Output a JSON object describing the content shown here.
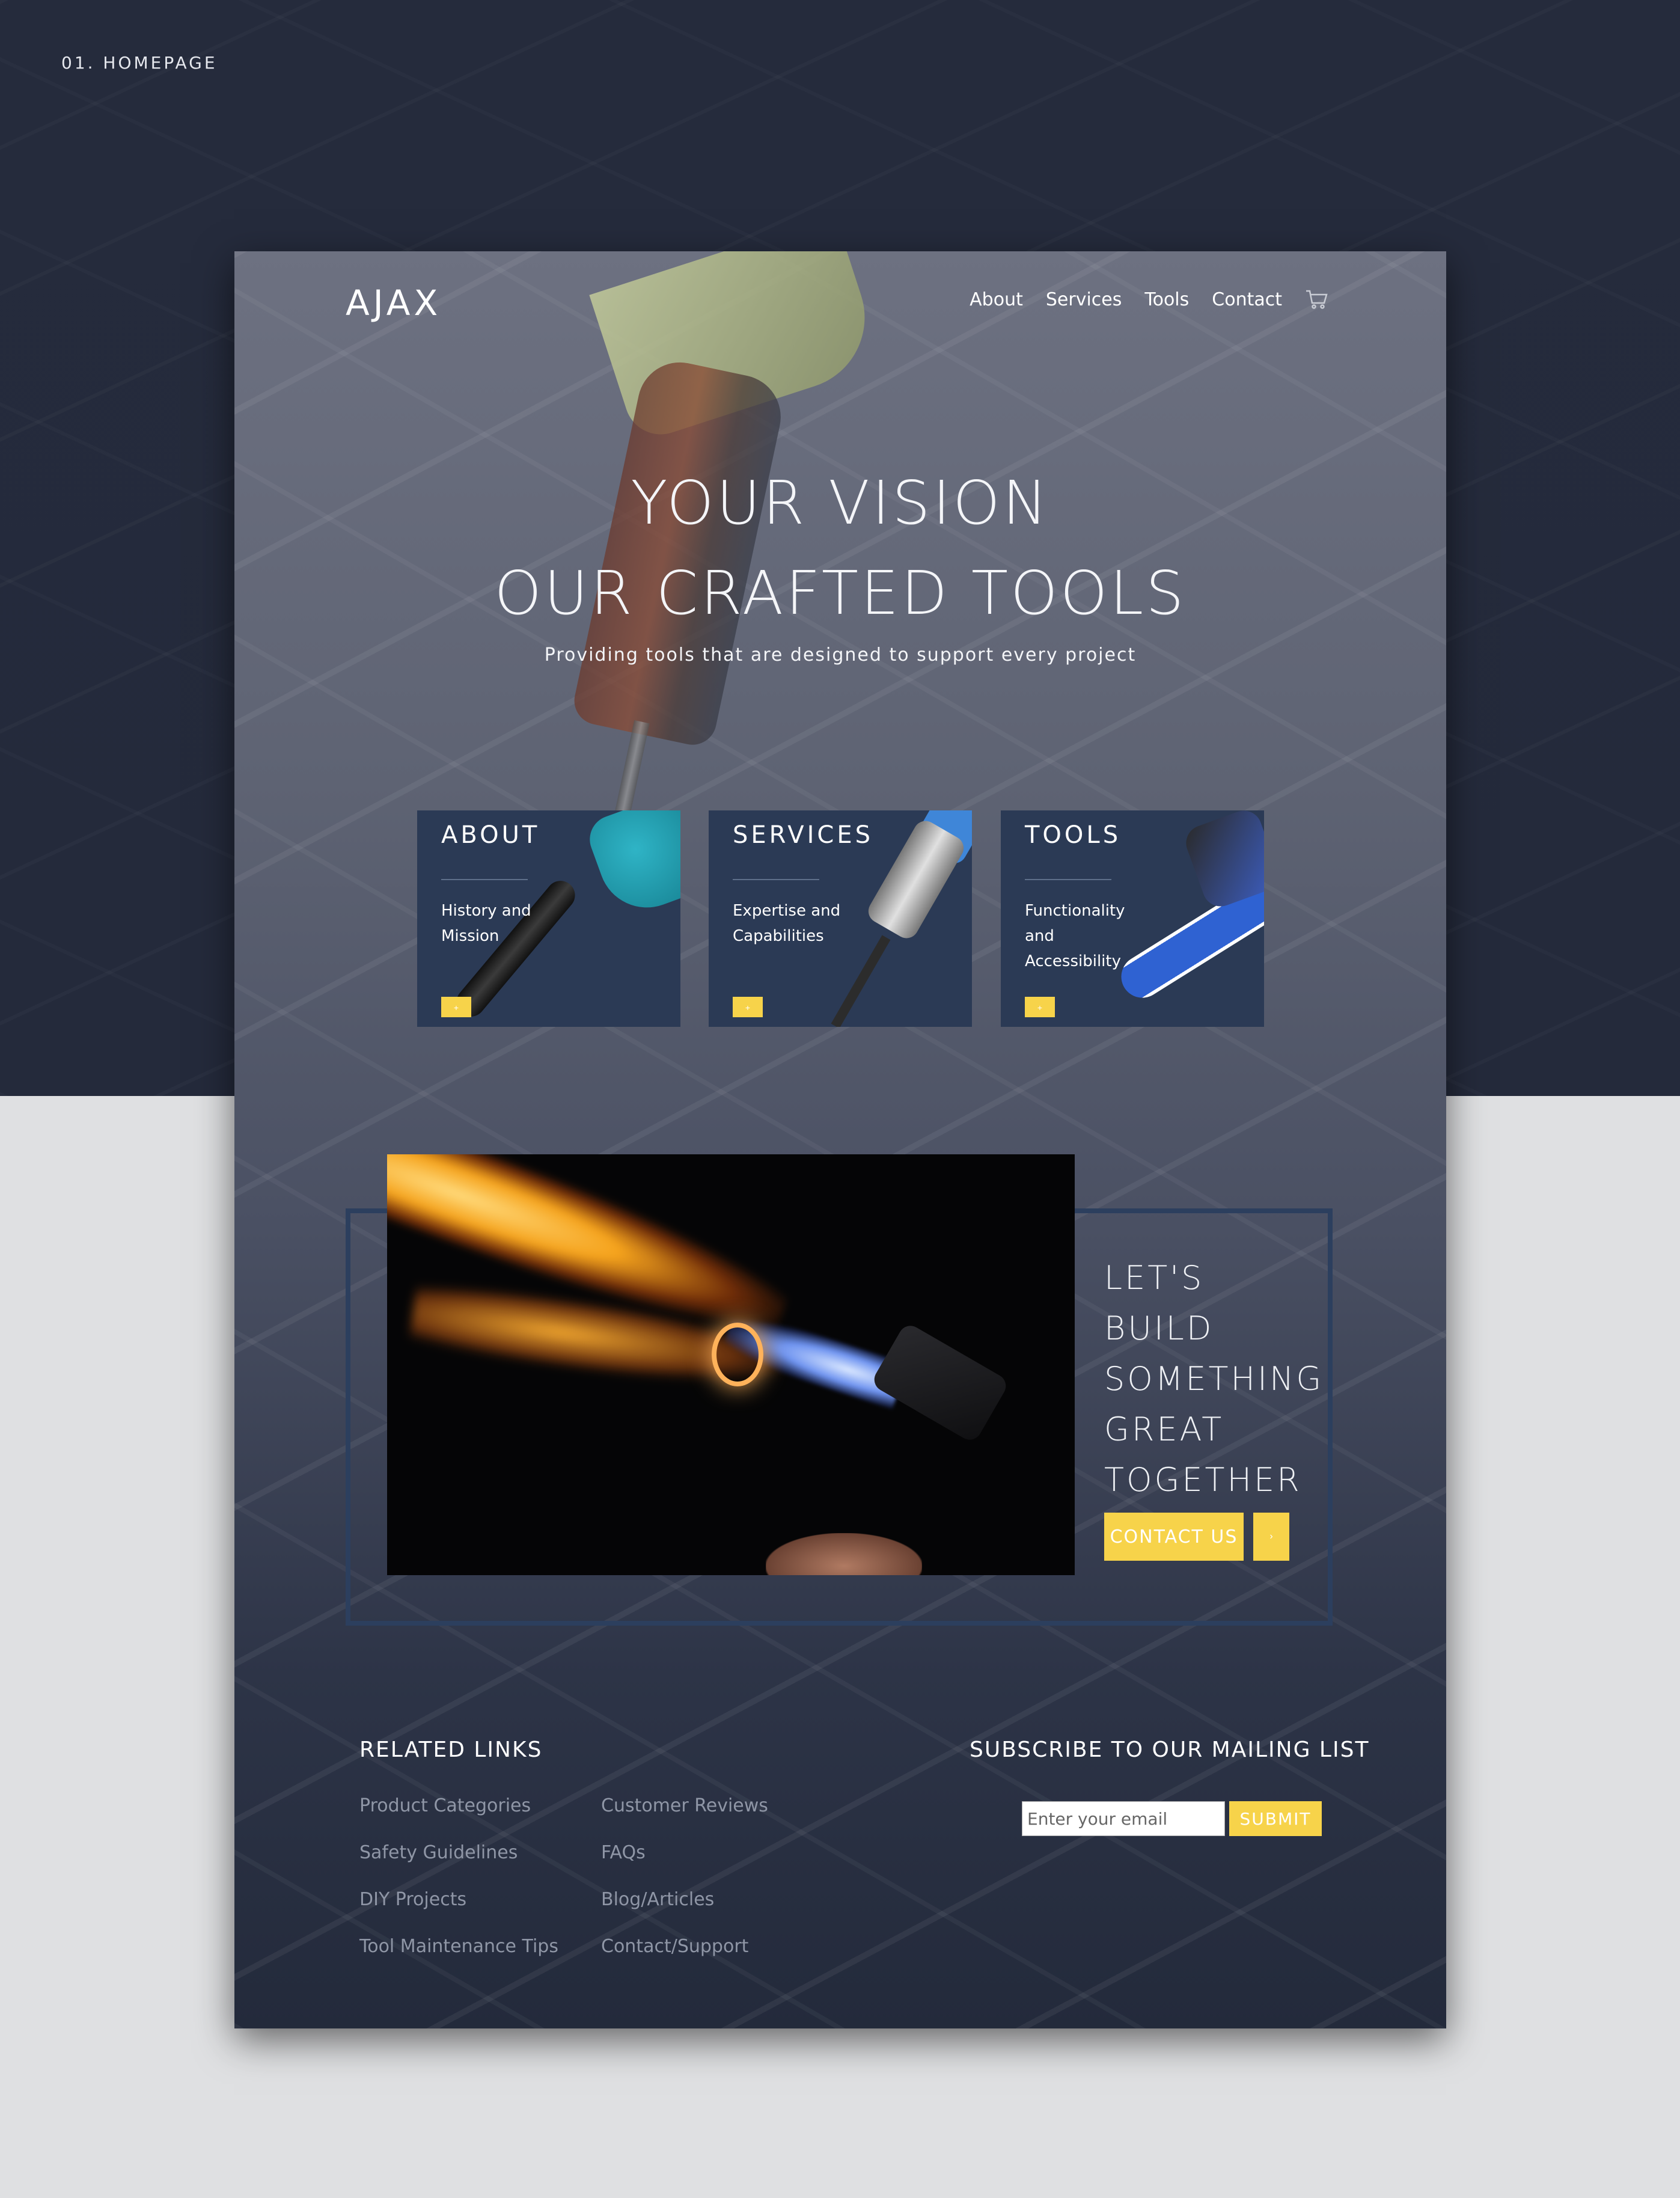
{
  "page_label": "01. HOMEPAGE",
  "site": {
    "logo": "AJAX",
    "nav": [
      "About",
      "Services",
      "Tools",
      "Contact"
    ],
    "cart_icon": "cart-icon"
  },
  "hero": {
    "title_line1": "YOUR VISION",
    "title_line2": "OUR CRAFTED TOOLS",
    "subtitle": "Providing tools that are designed to support every project"
  },
  "cards": [
    {
      "title": "ABOUT",
      "description": "History and Mission",
      "button_label": "+",
      "image": "leaf-blower"
    },
    {
      "title": "SERVICES",
      "description": "Expertise and Capabilities",
      "button_label": "+",
      "image": "demolition-hammer"
    },
    {
      "title": "TOOLS",
      "description": "Functionality and Accessibility",
      "button_label": "+",
      "image": "chainsaw"
    }
  ],
  "cta": {
    "title_lines": [
      "LET'S",
      "BUILD",
      "SOMETHING",
      "GREAT",
      "TOGETHER"
    ],
    "button_label": "CONTACT US",
    "arrow_label": "›",
    "image": "torch-flame-photo"
  },
  "footer": {
    "related_heading": "RELATED LINKS",
    "links_col1": [
      "Product Categories",
      "Safety Guidelines",
      "DIY Projects",
      "Tool Maintenance Tips"
    ],
    "links_col2": [
      "Customer Reviews",
      "FAQs",
      "Blog/Articles",
      "Contact/Support"
    ],
    "subscribe_heading": "SUBSCRIBE TO OUR MAILING LIST",
    "email_placeholder": "Enter your email",
    "submit_label": "SUBMIT"
  },
  "colors": {
    "accent": "#f7d34a",
    "card_bg": "#2b3a55",
    "page_dark": "#242a3c",
    "page_light": "#dfe0e2"
  }
}
